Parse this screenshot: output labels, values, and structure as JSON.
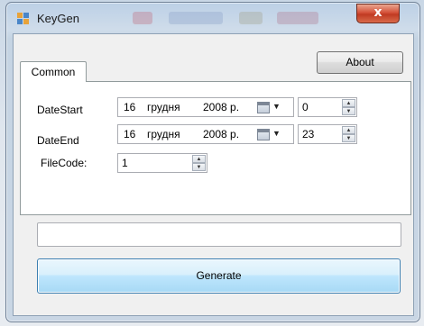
{
  "window": {
    "title": "KeyGen",
    "close_label": "x"
  },
  "tabs": [
    {
      "label": "Common"
    }
  ],
  "about_button": "About",
  "fields": {
    "date_start": {
      "label": "DateStart",
      "day": "16",
      "month": "грудня",
      "year": "2008 р.",
      "hour": "0"
    },
    "date_end": {
      "label": "DateEnd",
      "day": "16",
      "month": "грудня",
      "year": "2008 р.",
      "hour": "23"
    },
    "file_code": {
      "label": "FileCode:",
      "value": "1"
    }
  },
  "output": {
    "value": ""
  },
  "generate_button": "Generate",
  "colors": {
    "close_button": "#c74128",
    "generate_button": "#bee6fd",
    "frame": "#c9d6e4"
  }
}
